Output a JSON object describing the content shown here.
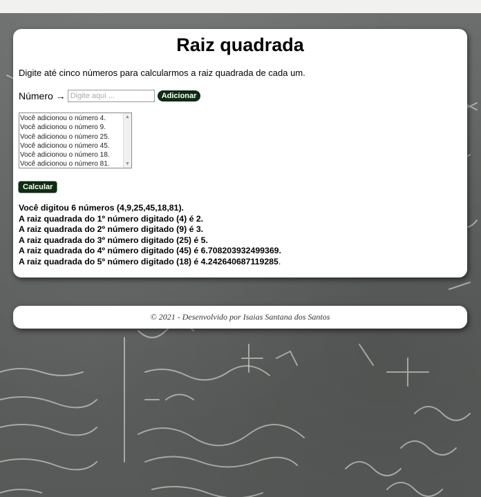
{
  "page": {
    "title": "Raiz quadrada",
    "description": "Digite até cinco números para calcularmos a raiz quadrada de cada um."
  },
  "form": {
    "label": "Número →",
    "input_placeholder": "Digite aqui ...",
    "input_value": "",
    "add_button": "Adicionar",
    "calc_button": "Calcular"
  },
  "list_items": [
    "Você adicionou o número 4.",
    "Você adicionou o número 9.",
    "Você adicionou o número 25.",
    "Você adicionou o número 45.",
    "Você adicionou o número 18.",
    "Você adicionou o número 81."
  ],
  "results": {
    "summary": "Você digitou 6 números (4,9,25,45,18,81).",
    "lines": [
      "A raiz quadrada do 1º número digitado (4) é 2.",
      "A raiz quadrada do 2º número digitado (9) é 3.",
      "A raiz quadrada do 3º número digitado (25) é 5.",
      "A raiz quadrada do 4º número digitado (45) é 6.708203932499369.",
      "A raiz quadrada do 5º número digitado (18) é 4.242640687119285."
    ]
  },
  "footer": {
    "text": "© 2021 - Desenvolvido por Isaias Santana dos Santos"
  },
  "colors": {
    "button_bg": "#0e2e12",
    "chalkboard": "#5f6260"
  },
  "icons": {
    "arrow": "→",
    "scroll_up": "▲",
    "scroll_down": "▼"
  }
}
